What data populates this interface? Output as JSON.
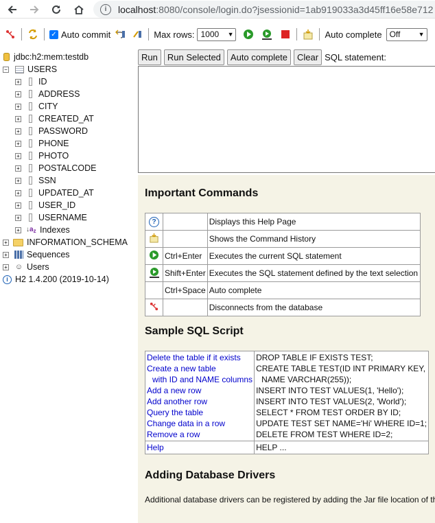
{
  "browser": {
    "url_host": "localhost",
    "url_path": ":8080/console/login.do?jsessionid=1ab919033a3d45ff16e58e712"
  },
  "toolbar": {
    "auto_commit_label": "Auto commit",
    "max_rows_label": "Max rows:",
    "max_rows_value": "1000",
    "auto_complete_label": "Auto complete",
    "auto_complete_value": "Off"
  },
  "tree": {
    "connection": "jdbc:h2:mem:testdb",
    "table": "USERS",
    "columns": [
      "ID",
      "ADDRESS",
      "CITY",
      "CREATED_AT",
      "PASSWORD",
      "PHONE",
      "PHOTO",
      "POSTALCODE",
      "SSN",
      "UPDATED_AT",
      "USER_ID",
      "USERNAME"
    ],
    "indexes": "Indexes",
    "information_schema": "INFORMATION_SCHEMA",
    "sequences": "Sequences",
    "users": "Users",
    "version": "H2 1.4.200 (2019-10-14)"
  },
  "query": {
    "run": "Run",
    "run_selected": "Run Selected",
    "auto_complete": "Auto complete",
    "clear": "Clear",
    "sql_label": "SQL statement:"
  },
  "help": {
    "important_title": "Important Commands",
    "commands": [
      {
        "icon": "help-icon",
        "key": "",
        "desc": "Displays this Help Page"
      },
      {
        "icon": "history-icon",
        "key": "",
        "desc": "Shows the Command History"
      },
      {
        "icon": "run-icon",
        "key": "Ctrl+Enter",
        "desc": "Executes the current SQL statement"
      },
      {
        "icon": "run-selected-icon",
        "key": "Shift+Enter",
        "desc": "Executes the SQL statement defined by the text selection"
      },
      {
        "icon": "",
        "key": "Ctrl+Space",
        "desc": "Auto complete"
      },
      {
        "icon": "disconnect-icon",
        "key": "",
        "desc": "Disconnects from the database"
      }
    ],
    "sample_title": "Sample SQL Script",
    "sample_links": [
      "Delete the table if it exists",
      "Create a new table",
      "with ID and NAME columns",
      "Add a new row",
      "Add another row",
      "Query the table",
      "Change data in a row",
      "Remove a row"
    ],
    "sample_code": [
      "DROP TABLE IF EXISTS TEST;",
      "CREATE TABLE TEST(ID INT PRIMARY KEY,",
      "NAME VARCHAR(255));",
      "INSERT INTO TEST VALUES(1, 'Hello');",
      "INSERT INTO TEST VALUES(2, 'World');",
      "SELECT * FROM TEST ORDER BY ID;",
      "UPDATE TEST SET NAME='Hi' WHERE ID=1;",
      "DELETE FROM TEST WHERE ID=2;"
    ],
    "help_link": "Help",
    "help_code": "HELP ...",
    "drivers_title": "Adding Database Drivers",
    "drivers_text": "Additional database drivers can be registered by adding the Jar file location of th"
  }
}
